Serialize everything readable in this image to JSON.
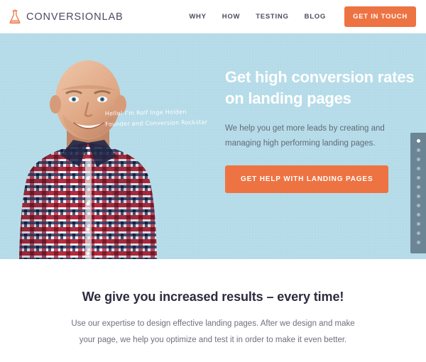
{
  "header": {
    "logo_icon": "flask-icon",
    "brand_name": "CONVERSIONLAB",
    "nav_items": [
      {
        "label": "WHY"
      },
      {
        "label": "HOW"
      },
      {
        "label": "TESTING"
      },
      {
        "label": "BLOG"
      }
    ],
    "cta_label": "GET IN TOUCH"
  },
  "hero": {
    "title": "Get high conversion rates on landing pages",
    "subtitle": "We help you get more leads by creating and managing high performing landing pages.",
    "cta_label": "GET HELP WITH LANDING PAGES",
    "handwriting_line1": "Hello! I'm Rolf Inge Holden",
    "handwriting_line2": "Founder and Conversion Rockstar",
    "photo_alt": "portrait-of-founder",
    "background_color": "#b5dbe8"
  },
  "dot_nav": {
    "total": 12,
    "active_index": 0
  },
  "section": {
    "title": "We give you increased results – every time!",
    "body": "Use our expertise to design effective landing pages. After we design and make your page, we help you optimize and test it in order to make it even better."
  },
  "colors": {
    "accent_orange": "#ee7342",
    "hero_blue": "#b5dbe8",
    "text_dark": "#4b4a63",
    "heading_dark": "#2f2b3f",
    "body_gray": "#6f6f7c"
  }
}
